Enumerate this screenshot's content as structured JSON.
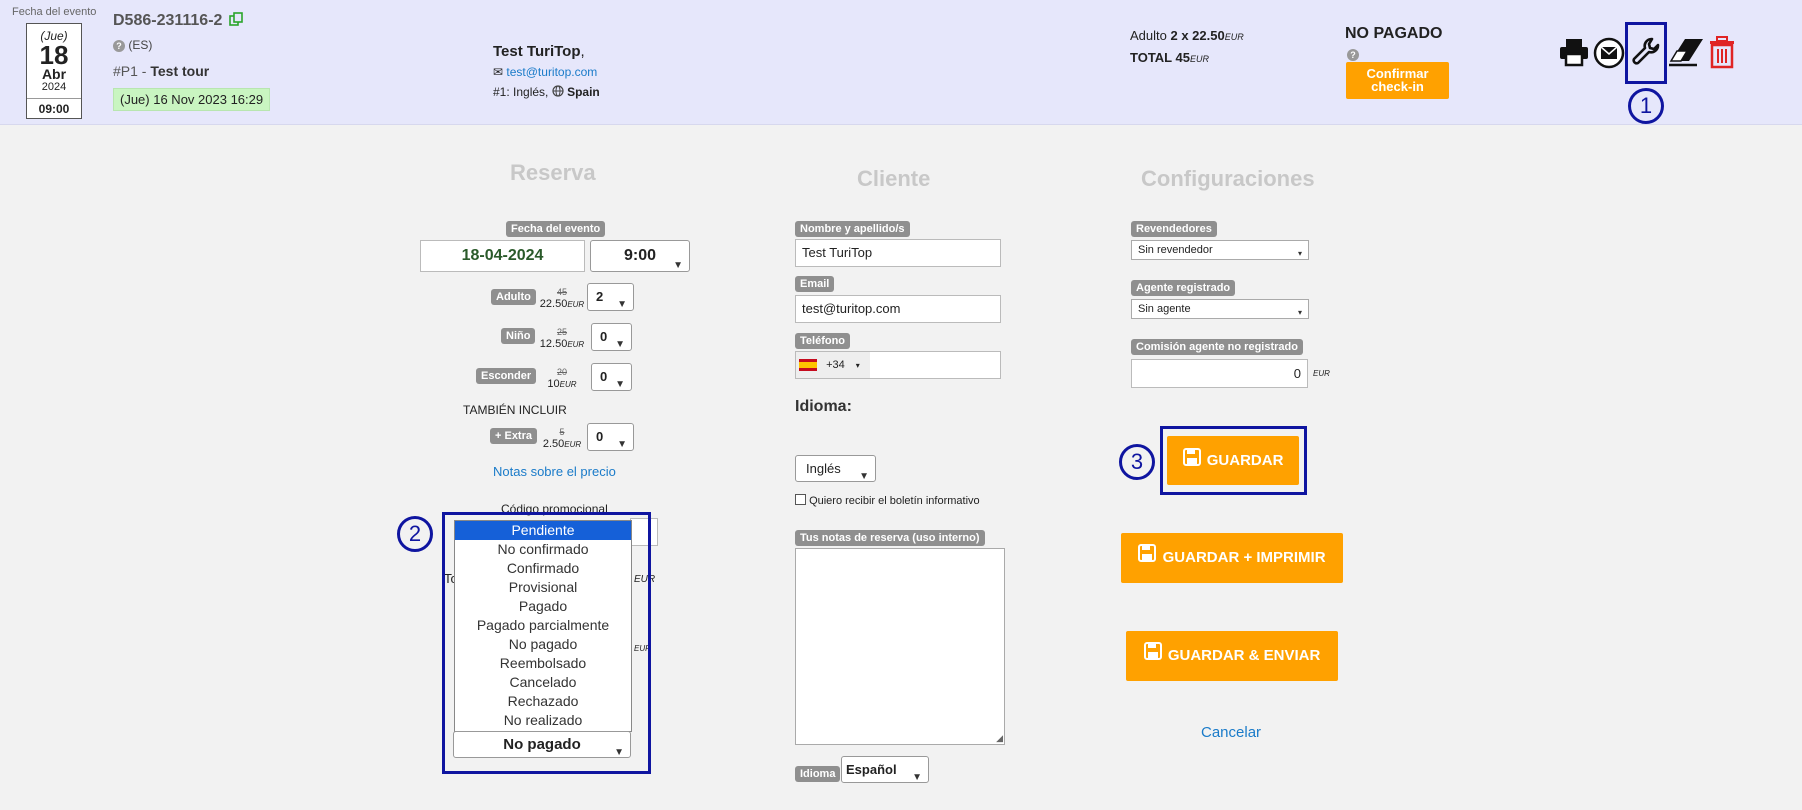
{
  "header": {
    "date_label": "Fecha del evento",
    "date_box": {
      "dow": "(Jue)",
      "day": "18",
      "month": "Abr",
      "year": "2024",
      "time": "09:00"
    },
    "booking_id": "D586-231116-2",
    "lang": "(ES)",
    "product_prefix": "#P1",
    "product_name": "Test tour",
    "created": "(Jue) 16 Nov 2023 16:29",
    "customer_name": "Test TuriTop",
    "customer_email": "test@turitop.com",
    "customer_lang_prefix": "#1: Inglés,",
    "customer_country": "Spain",
    "price_line_label": "Adulto",
    "price_line_value": "2 x 22.50",
    "total_label": "TOTAL",
    "total_value": "45",
    "currency": "EUR",
    "status": "NO PAGADO",
    "checkin_button": "Confirmar check-in"
  },
  "toolbar_icons": [
    "printer-icon",
    "mail-icon",
    "wrench-icon",
    "eraser-icon",
    "trash-icon"
  ],
  "annotations": {
    "one": "1",
    "two": "2",
    "three": "3"
  },
  "reserva": {
    "title": "Reserva",
    "fecha_label": "Fecha del evento",
    "fecha_value": "18-04-2024",
    "hora_value": "9:00",
    "lines": [
      {
        "label": "Adulto",
        "old": "45",
        "price": "22.50",
        "qty": "2"
      },
      {
        "label": "Niño",
        "old": "25",
        "price": "12.50",
        "qty": "0"
      },
      {
        "label": "Esconder",
        "old": "20",
        "price": "10",
        "qty": "0"
      }
    ],
    "also_include": "TAMBIÉN INCLUIR",
    "extra": {
      "label": "+ Extra",
      "old": "5",
      "price": "2.50",
      "qty": "0"
    },
    "notes_link": "Notas sobre el precio",
    "promo_label": "Código promocional",
    "hidden_t": "To",
    "eur_partial": "EUR",
    "status_select": "No pagado",
    "status_options": [
      "Pendiente",
      "No confirmado",
      "Confirmado",
      "Provisional",
      "Pagado",
      "Pagado parcialmente",
      "No pagado",
      "Reembolsado",
      "Cancelado",
      "Rechazado",
      "No realizado"
    ]
  },
  "cliente": {
    "title": "Cliente",
    "name_label": "Nombre y apellido/s",
    "name_value": "Test TuriTop",
    "email_label": "Email",
    "email_value": "test@turitop.com",
    "phone_label": "Teléfono",
    "phone_code": "+34",
    "idioma_title": "Idioma:",
    "idioma_value": "Inglés",
    "newsletter": "Quiero recibir el boletín informativo",
    "notes_label": "Tus notas de reserva (uso interno)",
    "idioma_small_label": "Idioma",
    "idioma_small_value": "Español"
  },
  "config": {
    "title": "Configuraciones",
    "revendedores_label": "Revendedores",
    "revendedores_value": "Sin revendedor",
    "agente_label": "Agente registrado",
    "agente_value": "Sin agente",
    "comision_label": "Comisión agente no registrado",
    "comision_value": "0",
    "guardar": "GUARDAR",
    "guardar_imprimir": "GUARDAR + IMPRIMIR",
    "guardar_enviar": "GUARDAR & ENVIAR",
    "cancelar": "Cancelar"
  },
  "colors": {
    "accent": "#ffa100",
    "header_bg": "#e6e7fb",
    "annotation": "#0f15a0",
    "link": "#1a7bc9",
    "selected": "#1560d8"
  }
}
